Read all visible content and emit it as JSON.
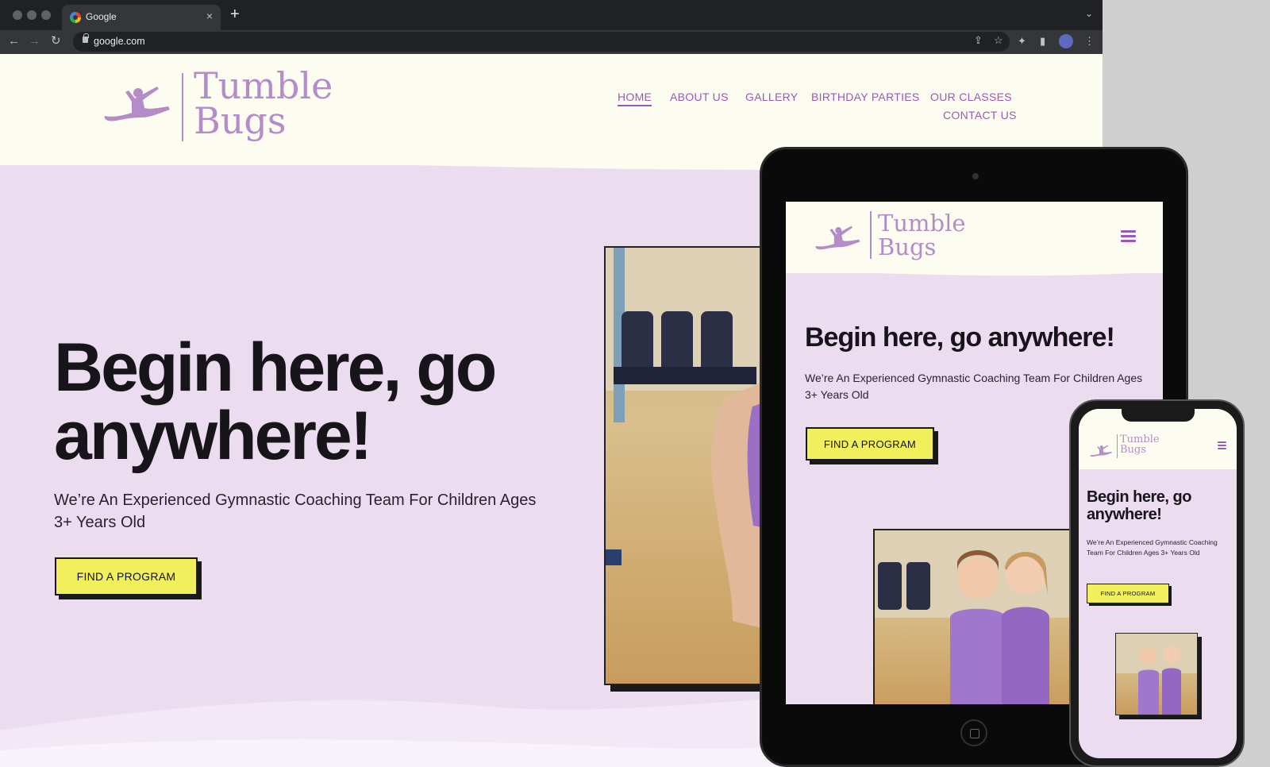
{
  "browser": {
    "tab_title": "Google",
    "tab_close": "×",
    "new_tab": "+",
    "tab_menu": "⌄",
    "url": "google.com",
    "back": "←",
    "forward": "→",
    "reload": "↻",
    "share": "⇪",
    "bookmark": "☆",
    "extensions": "✦",
    "sidepanel": "▮",
    "menu": "⋮"
  },
  "site": {
    "logo_line1": "Tumble",
    "logo_line2": "Bugs",
    "nav": [
      "HOME",
      "ABOUT US",
      "GALLERY",
      "BIRTHDAY PARTIES",
      "OUR CLASSES",
      "CONTACT US"
    ],
    "hero_title": "Begin here, go anywhere!",
    "hero_subtitle": "We’re An Experienced Gymnastic Coaching Team For Children Ages 3+ Years Old",
    "cta_label": "FIND A PROGRAM"
  },
  "colors": {
    "brand_purple": "#9b59b6",
    "hero_bg": "#ecdcf0",
    "header_bg": "#fdfcf0",
    "cta_yellow": "#f2ef5c"
  },
  "icons": [
    "google-favicon",
    "lock-icon",
    "share-icon",
    "star-icon",
    "puzzle-icon",
    "sidepanel-icon",
    "profile-avatar",
    "kebab-menu-icon",
    "hamburger-menu-icon",
    "gymnast-logo-icon"
  ]
}
